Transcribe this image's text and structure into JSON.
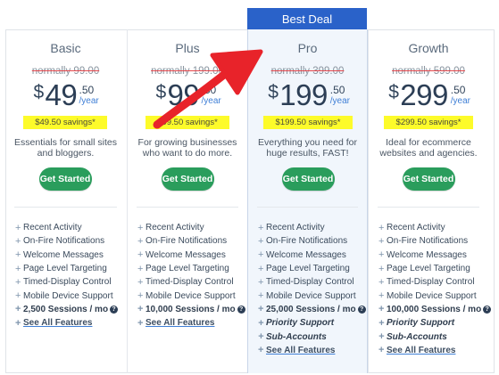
{
  "banner": "Best Deal",
  "plans": [
    {
      "name": "Basic",
      "normal": "normally 99.00",
      "dollar": "$",
      "amount": "49",
      "cents": ".50",
      "year": "/year",
      "savings": "$49.50 savings*",
      "desc": "Essentials for small sites and bloggers.",
      "cta": "Get Started",
      "features": [
        {
          "t": "Recent Activity"
        },
        {
          "t": "On-Fire Notifications"
        },
        {
          "t": "Welcome Messages"
        },
        {
          "t": "Page Level Targeting"
        },
        {
          "t": "Timed-Display Control"
        },
        {
          "t": "Mobile Device Support"
        },
        {
          "t": "2,500 Sessions / mo",
          "style": "bold",
          "help": "?"
        },
        {
          "t": "See All Features",
          "style": "link"
        }
      ]
    },
    {
      "name": "Plus",
      "normal": "normally 199.00",
      "dollar": "$",
      "amount": "99",
      "cents": ".50",
      "year": "/year",
      "savings": "$99.50 savings*",
      "desc": "For growing businesses who want to do more.",
      "cta": "Get Started",
      "features": [
        {
          "t": "Recent Activity"
        },
        {
          "t": "On-Fire Notifications"
        },
        {
          "t": "Welcome Messages"
        },
        {
          "t": "Page Level Targeting"
        },
        {
          "t": "Timed-Display Control"
        },
        {
          "t": "Mobile Device Support"
        },
        {
          "t": "10,000 Sessions / mo",
          "style": "bold",
          "help": "?"
        },
        {
          "t": "See All Features",
          "style": "link"
        }
      ]
    },
    {
      "name": "Pro",
      "normal": "normally 399.00",
      "dollar": "$",
      "amount": "199",
      "cents": ".50",
      "year": "/year",
      "savings": "$199.50 savings*",
      "desc": "Everything you need for huge results, FAST!",
      "cta": "Get Started",
      "features": [
        {
          "t": "Recent Activity"
        },
        {
          "t": "On-Fire Notifications"
        },
        {
          "t": "Welcome Messages"
        },
        {
          "t": "Page Level Targeting"
        },
        {
          "t": "Timed-Display Control"
        },
        {
          "t": "Mobile Device Support"
        },
        {
          "t": "25,000 Sessions / mo",
          "style": "bold",
          "help": "?"
        },
        {
          "t": "Priority Support",
          "style": "bolditalic"
        },
        {
          "t": "Sub-Accounts",
          "style": "bolditalic"
        },
        {
          "t": "See All Features",
          "style": "link"
        }
      ]
    },
    {
      "name": "Growth",
      "normal": "normally 599.00",
      "dollar": "$",
      "amount": "299",
      "cents": ".50",
      "year": "/year",
      "savings": "$299.50 savings*",
      "desc": "Ideal for ecommerce websites and agencies.",
      "cta": "Get Started",
      "features": [
        {
          "t": "Recent Activity"
        },
        {
          "t": "On-Fire Notifications"
        },
        {
          "t": "Welcome Messages"
        },
        {
          "t": "Page Level Targeting"
        },
        {
          "t": "Timed-Display Control"
        },
        {
          "t": "Mobile Device Support"
        },
        {
          "t": "100,000 Sessions / mo",
          "style": "bold",
          "help": "?"
        },
        {
          "t": "Priority Support",
          "style": "bolditalic"
        },
        {
          "t": "Sub-Accounts",
          "style": "bolditalic"
        },
        {
          "t": "See All Features",
          "style": "link"
        }
      ]
    }
  ],
  "icons": {
    "feature_bullet": "plus-icon",
    "help": "question-circle-icon",
    "annotation": "red-arrow-icon"
  },
  "colors": {
    "accent_blue": "#2a62c9",
    "button_green": "#2a9d5c",
    "savings_yellow": "#fdfb2a",
    "strike_red": "#e5484d",
    "arrow_red": "#e8232a",
    "pro_bg": "#f1f6fc"
  }
}
